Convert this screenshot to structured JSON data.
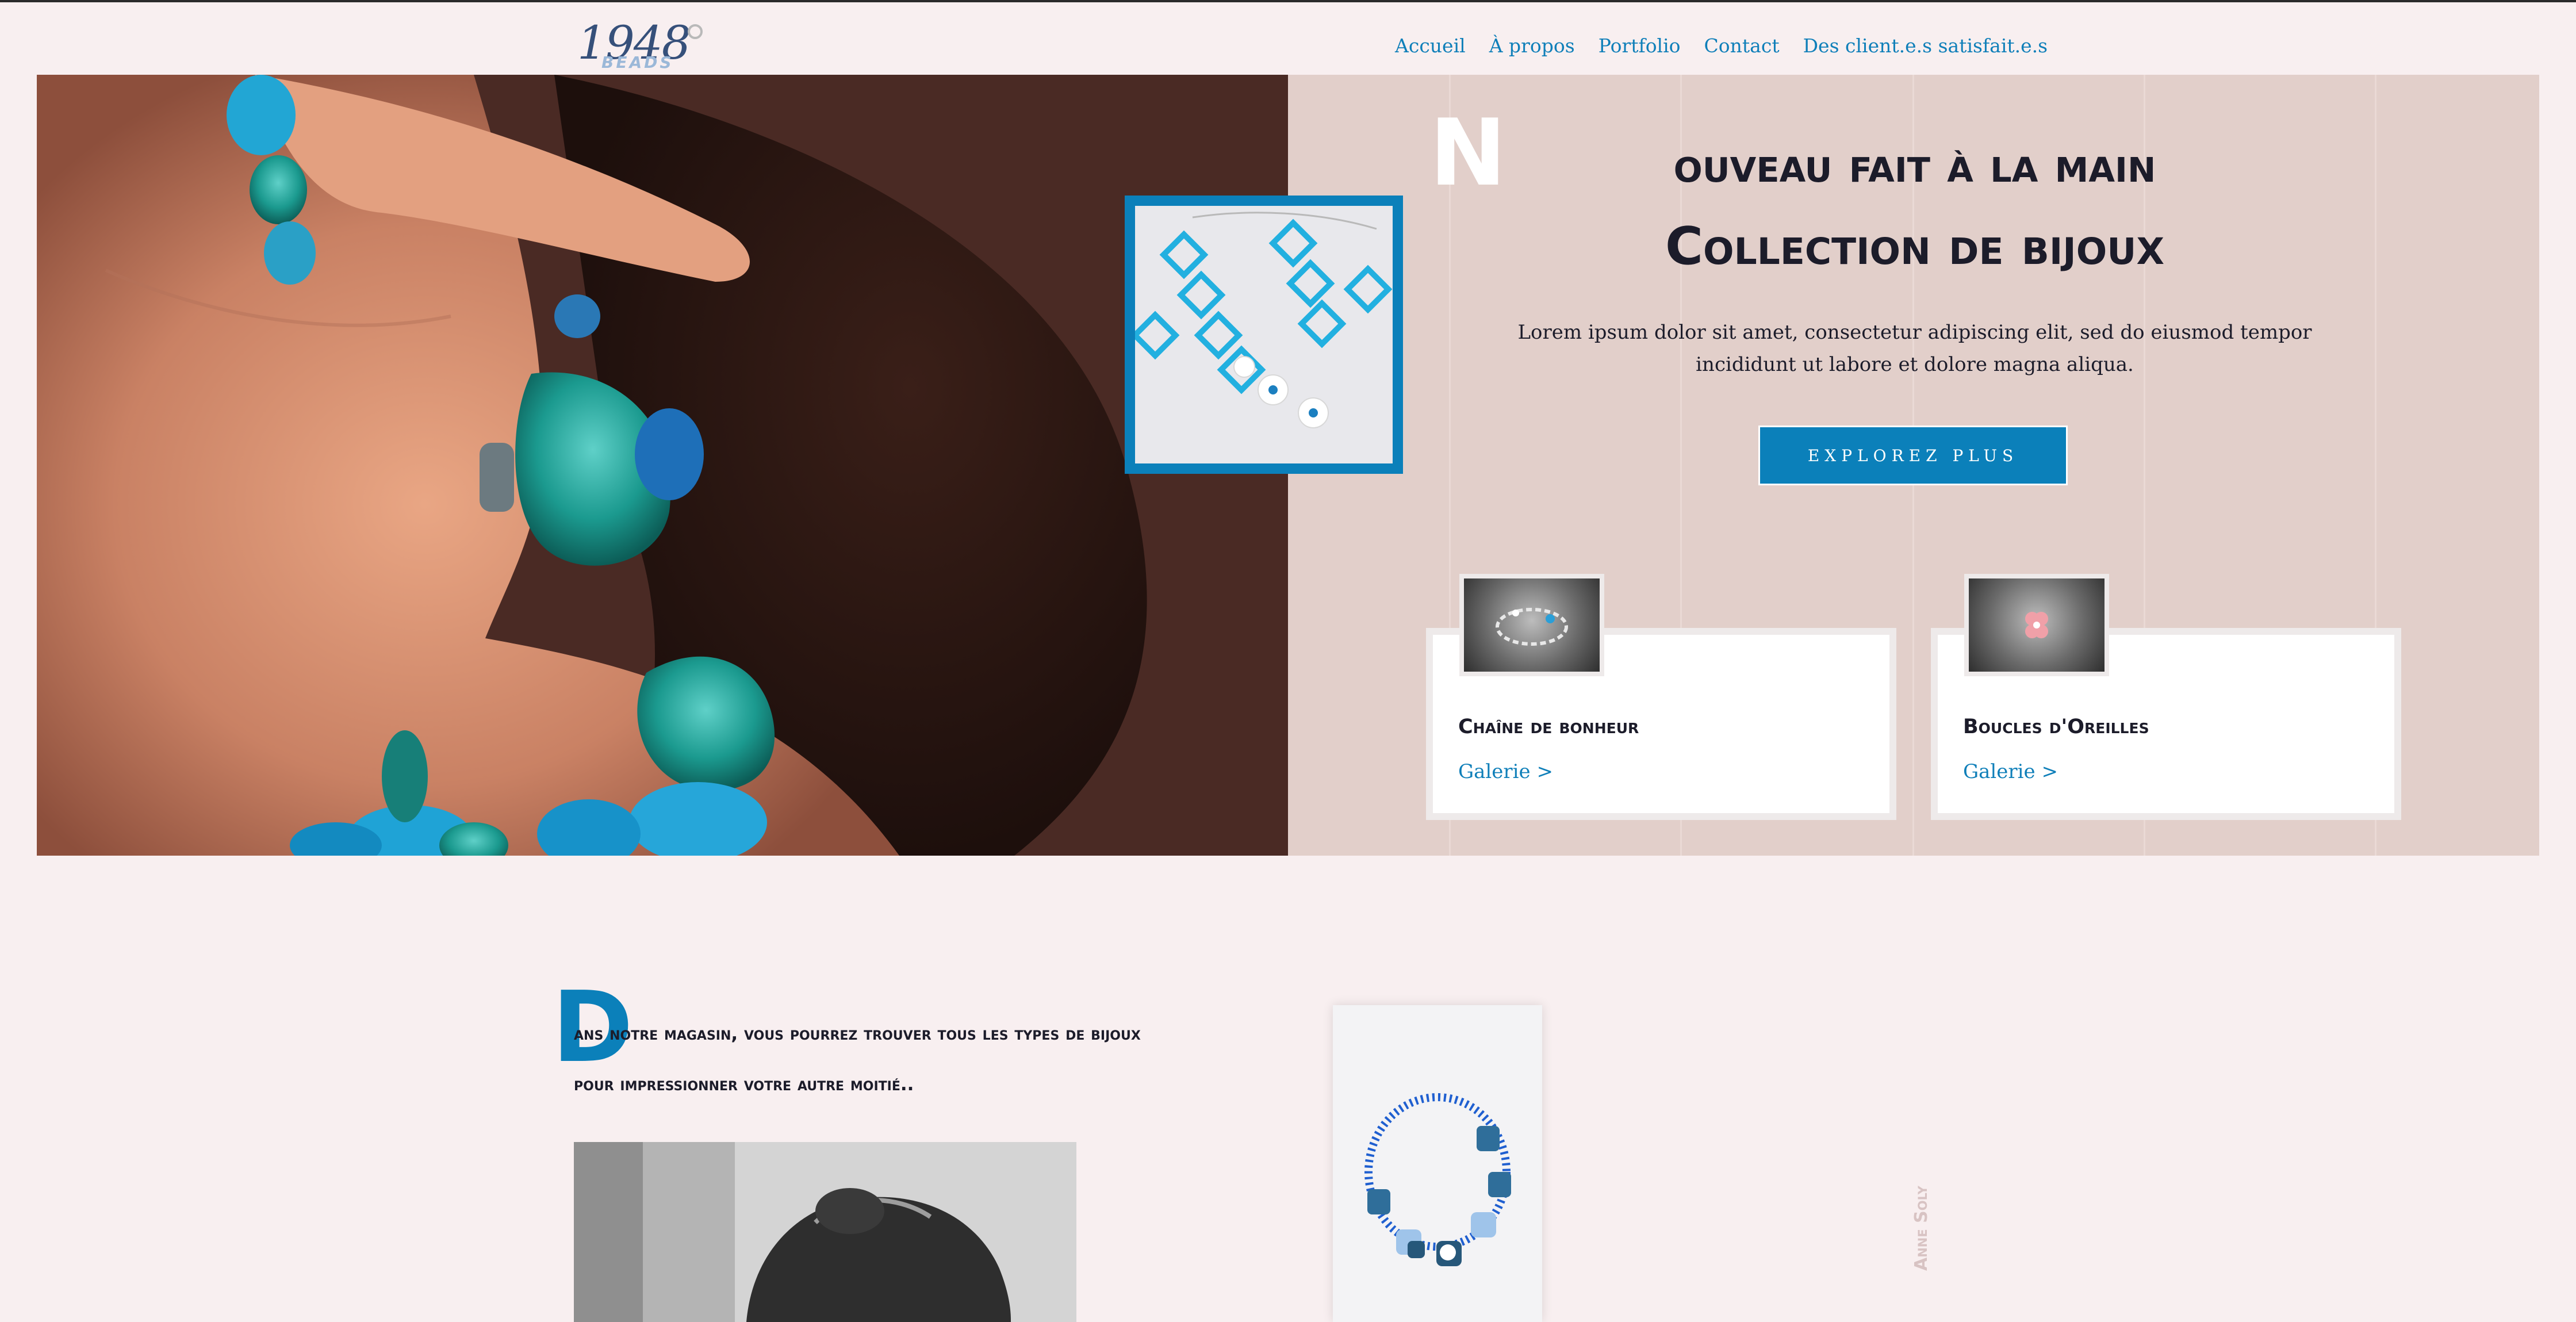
{
  "brand": {
    "logo_text": "1948",
    "logo_sub": "BEADS"
  },
  "nav": {
    "items": [
      {
        "label": "Accueil"
      },
      {
        "label": "À propos"
      },
      {
        "label": "Portfolio"
      },
      {
        "label": "Contact"
      },
      {
        "label": "Des client.e.s satisfait.e.s"
      }
    ]
  },
  "hero": {
    "dropcap": "N",
    "title_line1": "ouveau fait à la main",
    "title_line2": "Collection de bijoux",
    "description": "Lorem ipsum dolor sit amet, consectetur adipiscing elit, sed do eiusmod tempor incididunt ut labore et dolore magna aliqua.",
    "button_label": "EXPLOREZ PLUS"
  },
  "cards": [
    {
      "title": "Chaîne de bonheur",
      "link": "Galerie >"
    },
    {
      "title": "Boucles d'Oreilles",
      "link": "Galerie >"
    }
  ],
  "intro": {
    "dropcap": "D",
    "text": "ans notre magasin, vous pourrez trouver tous les types de bijoux pour impressionner votre autre moitié.."
  },
  "side_caption": "Anne Soly",
  "colors": {
    "accent": "#0b80ba",
    "nav_link": "#0f7fb9",
    "hero_panel": "#e2cfca",
    "page_bg": "#f8eff0"
  }
}
